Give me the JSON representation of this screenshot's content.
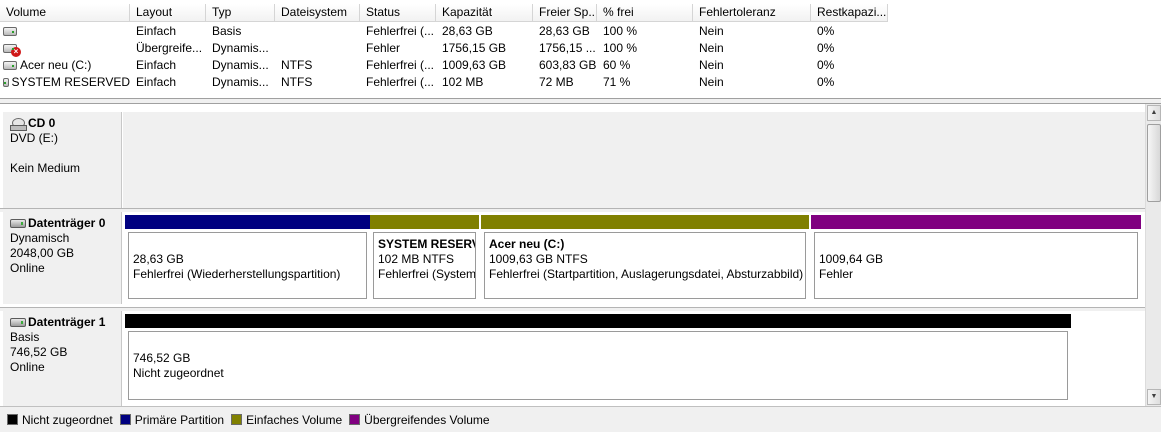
{
  "colors": {
    "unallocated": "#000000",
    "primary": "#000080",
    "simple": "#808000",
    "spanned": "#800080"
  },
  "columns": [
    "Volume",
    "Layout",
    "Typ",
    "Dateisystem",
    "Status",
    "Kapazität",
    "Freier Sp...",
    "% frei",
    "Fehlertoleranz",
    "Restkapazi..."
  ],
  "volumes": [
    {
      "icon": "drive-icon",
      "name": "",
      "layout": "Einfach",
      "type": "Basis",
      "fs": "",
      "status": "Fehlerfrei (...",
      "capacity": "28,63 GB",
      "free": "28,63 GB",
      "pct": "100 %",
      "fault": "Nein",
      "overhead": "0%"
    },
    {
      "icon": "drive-error-icon",
      "name": "",
      "layout": "Übergreife...",
      "type": "Dynamis...",
      "fs": "",
      "status": "Fehler",
      "capacity": "1756,15 GB",
      "free": "1756,15 ...",
      "pct": "100 %",
      "fault": "Nein",
      "overhead": "0%"
    },
    {
      "icon": "drive-icon",
      "name": "Acer neu (C:)",
      "layout": "Einfach",
      "type": "Dynamis...",
      "fs": "NTFS",
      "status": "Fehlerfrei (...",
      "capacity": "1009,63 GB",
      "free": "603,83 GB",
      "pct": "60 %",
      "fault": "Nein",
      "overhead": "0%"
    },
    {
      "icon": "drive-icon",
      "name": "SYSTEM RESERVED",
      "layout": "Einfach",
      "type": "Dynamis...",
      "fs": "NTFS",
      "status": "Fehlerfrei (...",
      "capacity": "102 MB",
      "free": "72 MB",
      "pct": "71 %",
      "fault": "Nein",
      "overhead": "0%"
    }
  ],
  "cd": {
    "name": "CD 0",
    "drive": "DVD (E:)",
    "status": "Kein Medium"
  },
  "disk0": {
    "name": "Datenträger 0",
    "type": "Dynamisch",
    "size": "2048,00 GB",
    "state": "Online",
    "partitions": [
      {
        "title": "",
        "size": "28,63 GB",
        "status": "Fehlerfrei (Wiederherstellungspartition)"
      },
      {
        "title": "SYSTEM RESERVI",
        "size": "102 MB NTFS",
        "status": "Fehlerfrei (System"
      },
      {
        "title": "Acer neu  (C:)",
        "size": "1009,63 GB NTFS",
        "status": "Fehlerfrei (Startpartition, Auslagerungsdatei, Absturzabbild)"
      },
      {
        "title": "",
        "size": "1009,64 GB",
        "status": "Fehler"
      }
    ]
  },
  "disk1": {
    "name": "Datenträger 1",
    "type": "Basis",
    "size": "746,52 GB",
    "state": "Online",
    "partitions": [
      {
        "size": "746,52 GB",
        "status": "Nicht zugeordnet"
      }
    ]
  },
  "legend": [
    "Nicht zugeordnet",
    "Primäre Partition",
    "Einfaches Volume",
    "Übergreifendes Volume"
  ]
}
